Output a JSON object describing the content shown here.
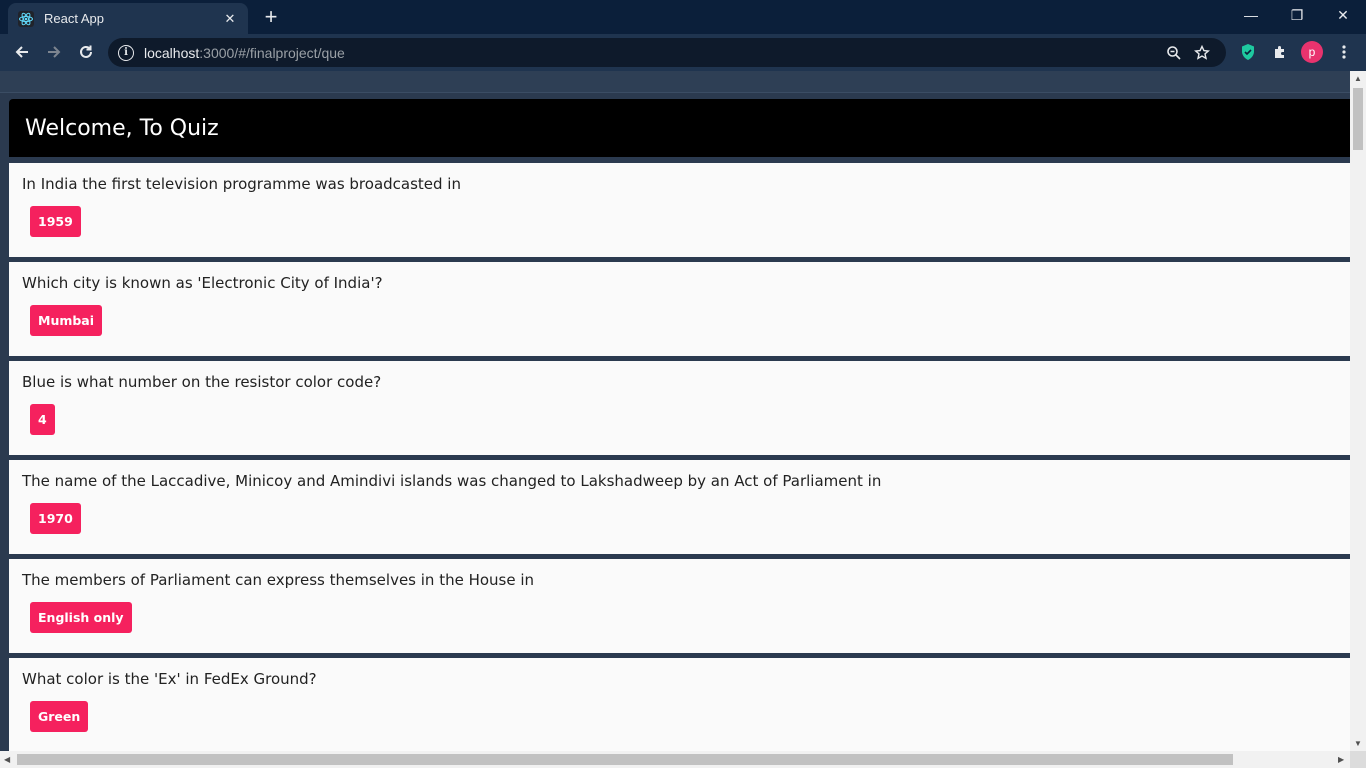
{
  "browser": {
    "tab_title": "React App",
    "tab_close": "✕",
    "new_tab": "+",
    "url_host": "localhost",
    "url_rest": ":3000/#/finalproject/que",
    "avatar_letter": "p",
    "minimize": "—",
    "restore": "❐",
    "close": "✕"
  },
  "quiz": {
    "title": "Welcome, To Quiz",
    "questions": [
      {
        "question": "In India the first television programme was broadcasted in",
        "answer": "1959"
      },
      {
        "question": "Which city is known as 'Electronic City of India'?",
        "answer": "Mumbai"
      },
      {
        "question": "Blue is what number on the resistor color code?",
        "answer": "4"
      },
      {
        "question": "The name of the Laccadive, Minicoy and Amindivi islands was changed to Lakshadweep by an Act of Parliament in",
        "answer": "1970"
      },
      {
        "question": "The members of Parliament can express themselves in the House in",
        "answer": "English only"
      },
      {
        "question": "What color is the 'Ex' in FedEx Ground?",
        "answer": "Green"
      }
    ]
  },
  "colors": {
    "answer_bg": "#f5215e",
    "header_bg": "#000000",
    "page_bg": "#2b3a4f",
    "card_bg": "#fafafa"
  }
}
